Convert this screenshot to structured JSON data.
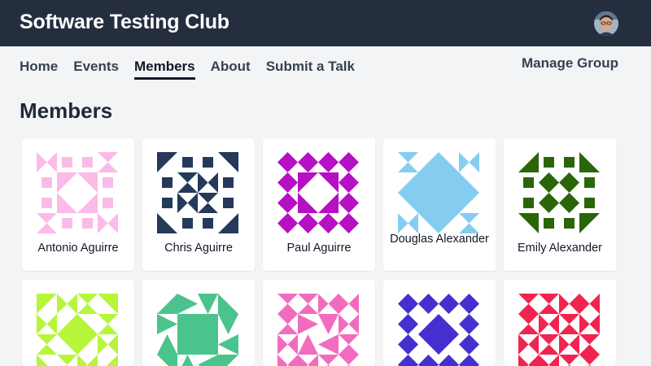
{
  "app": {
    "title": "Software Testing Club"
  },
  "nav": {
    "items": [
      {
        "label": "Home"
      },
      {
        "label": "Events"
      },
      {
        "label": "Members"
      },
      {
        "label": "About"
      },
      {
        "label": "Submit a Talk"
      }
    ],
    "active": "Members",
    "manage_label": "Manage Group"
  },
  "page": {
    "title": "Members"
  },
  "members": [
    {
      "name": "Antonio Aguirre",
      "avatar": "identicon",
      "color": "#fbbbe8"
    },
    {
      "name": "Chris Aguirre",
      "avatar": "identicon",
      "color": "#25395a"
    },
    {
      "name": "Paul Aguirre",
      "avatar": "identicon",
      "color": "#b60fc4"
    },
    {
      "name": "Douglas Alexander",
      "avatar": "identicon",
      "color": "#85cdf0"
    },
    {
      "name": "Emily Alexander",
      "avatar": "identicon",
      "color": "#2a6608"
    },
    {
      "name": "",
      "avatar": "identicon",
      "color": "#b6f53a"
    },
    {
      "name": "",
      "avatar": "identicon",
      "color": "#4ac48c"
    },
    {
      "name": "",
      "avatar": "identicon",
      "color": "#f26cbe"
    },
    {
      "name": "",
      "avatar": "identicon",
      "color": "#4530cf"
    },
    {
      "name": "",
      "avatar": "identicon",
      "color": "#f0244f"
    }
  ],
  "icons": {
    "user_avatar": "user-avatar-photo"
  }
}
